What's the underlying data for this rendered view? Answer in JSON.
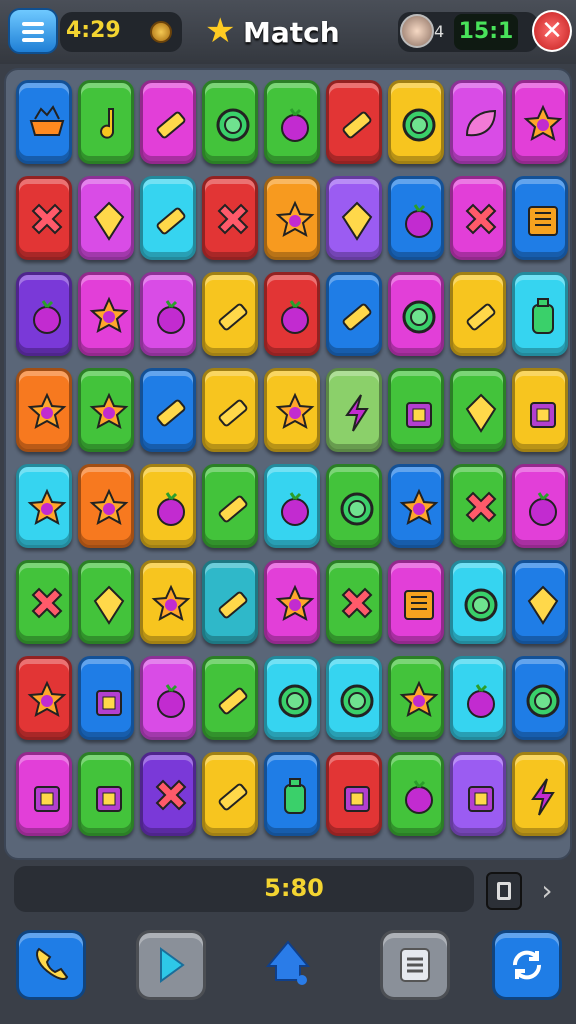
{
  "header": {
    "left_timer": "4:29",
    "title": "Match",
    "right_small": "4",
    "right_timer": "15:1",
    "close_label": "✕"
  },
  "footer": {
    "score": "5:80"
  },
  "colors": {
    "yellow_text": "#f3d431",
    "green_text": "#49e35a",
    "close_red": "#c31d1d"
  },
  "board": {
    "rows": [
      [
        {
          "c": "#1f7de6",
          "i": "bowl"
        },
        {
          "c": "#43c33b",
          "i": "note"
        },
        {
          "c": "#e23fd8",
          "i": "bar"
        },
        {
          "c": "#43c33b",
          "i": "ring"
        },
        {
          "c": "#43c33b",
          "i": "berry"
        },
        {
          "c": "#e23535",
          "i": "bar"
        },
        {
          "c": "#f7c51f",
          "i": "ring"
        },
        {
          "c": "#d94ce6",
          "i": "leaf"
        },
        {
          "c": "#e23fd8",
          "i": "star"
        }
      ],
      [
        {
          "c": "#e23535",
          "i": "cross"
        },
        {
          "c": "#d94ce6",
          "i": "gem"
        },
        {
          "c": "#36d4f0",
          "i": "bar"
        },
        {
          "c": "#e23535",
          "i": "cross"
        },
        {
          "c": "#f79a1f",
          "i": "star"
        },
        {
          "c": "#9b5cf2",
          "i": "gem"
        },
        {
          "c": "#1f7de6",
          "i": "berry"
        },
        {
          "c": "#e23fd8",
          "i": "cross"
        },
        {
          "c": "#1f7de6",
          "i": "grid"
        }
      ],
      [
        {
          "c": "#7a39d8",
          "i": "berry"
        },
        {
          "c": "#e23fd8",
          "i": "star"
        },
        {
          "c": "#d94ce6",
          "i": "berry"
        },
        {
          "c": "#f7c51f",
          "i": "bar"
        },
        {
          "c": "#e23535",
          "i": "berry"
        },
        {
          "c": "#1f7de6",
          "i": "bar"
        },
        {
          "c": "#e23fd8",
          "i": "ring"
        },
        {
          "c": "#f7c51f",
          "i": "bar"
        },
        {
          "c": "#36d4f0",
          "i": "jar"
        }
      ],
      [
        {
          "c": "#f7791f",
          "i": "star"
        },
        {
          "c": "#43c33b",
          "i": "star"
        },
        {
          "c": "#1f7de6",
          "i": "bar"
        },
        {
          "c": "#f7c51f",
          "i": "bar"
        },
        {
          "c": "#f7c51f",
          "i": "star"
        },
        {
          "c": "#8bd06a",
          "i": "bolt"
        },
        {
          "c": "#43c33b",
          "i": "box"
        },
        {
          "c": "#43c33b",
          "i": "gem"
        },
        {
          "c": "#f7c51f",
          "i": "box"
        }
      ],
      [
        {
          "c": "#36d4f0",
          "i": "star"
        },
        {
          "c": "#f7791f",
          "i": "star"
        },
        {
          "c": "#f7c51f",
          "i": "berry"
        },
        {
          "c": "#43c33b",
          "i": "bar"
        },
        {
          "c": "#36d4f0",
          "i": "berry"
        },
        {
          "c": "#43c33b",
          "i": "ring"
        },
        {
          "c": "#1f7de6",
          "i": "star"
        },
        {
          "c": "#43c33b",
          "i": "cross"
        },
        {
          "c": "#e23fd8",
          "i": "berry"
        }
      ],
      [
        {
          "c": "#43c33b",
          "i": "cross"
        },
        {
          "c": "#43c33b",
          "i": "gem"
        },
        {
          "c": "#f7c51f",
          "i": "star"
        },
        {
          "c": "#2fb8c9",
          "i": "bar"
        },
        {
          "c": "#e23fd8",
          "i": "star"
        },
        {
          "c": "#43c33b",
          "i": "cross"
        },
        {
          "c": "#e23fd8",
          "i": "grid"
        },
        {
          "c": "#36d4f0",
          "i": "ring"
        },
        {
          "c": "#1f7de6",
          "i": "gem"
        }
      ],
      [
        {
          "c": "#e23535",
          "i": "star"
        },
        {
          "c": "#1f7de6",
          "i": "box"
        },
        {
          "c": "#d94ce6",
          "i": "berry"
        },
        {
          "c": "#43c33b",
          "i": "bar"
        },
        {
          "c": "#36d4f0",
          "i": "ring"
        },
        {
          "c": "#36d4f0",
          "i": "ring"
        },
        {
          "c": "#43c33b",
          "i": "star"
        },
        {
          "c": "#36d4f0",
          "i": "berry"
        },
        {
          "c": "#1f7de6",
          "i": "ring"
        }
      ],
      [
        {
          "c": "#e23fd8",
          "i": "box"
        },
        {
          "c": "#43c33b",
          "i": "box"
        },
        {
          "c": "#7a39d8",
          "i": "cross"
        },
        {
          "c": "#f7c51f",
          "i": "bar"
        },
        {
          "c": "#1f7de6",
          "i": "jar"
        },
        {
          "c": "#e23535",
          "i": "box"
        },
        {
          "c": "#43c33b",
          "i": "berry"
        },
        {
          "c": "#9b5cf2",
          "i": "box"
        },
        {
          "c": "#f7c51f",
          "i": "bolt"
        }
      ]
    ]
  },
  "actions": [
    {
      "name": "phone-icon",
      "c": "#1f7de6"
    },
    {
      "name": "play-icon",
      "c": "#8a9099"
    },
    {
      "name": "home-icon",
      "c": "#1f7de6"
    },
    {
      "name": "list-icon",
      "c": "#8a9099"
    },
    {
      "name": "refresh-icon",
      "c": "#1f7de6"
    }
  ]
}
